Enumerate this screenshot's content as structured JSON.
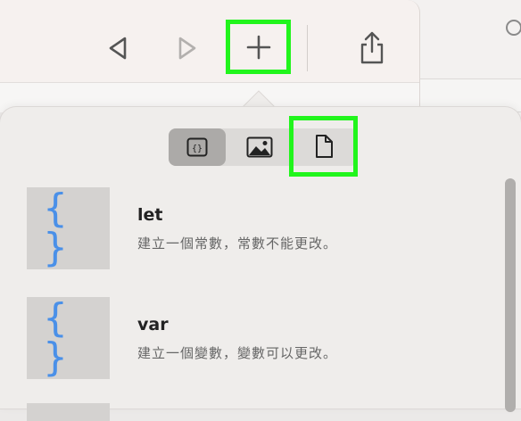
{
  "toolbar": {
    "back_icon": "chevron-left-icon",
    "forward_icon": "chevron-right-icon",
    "add_icon": "plus-icon",
    "share_icon": "share-icon",
    "highlight_color": "#21f51c"
  },
  "popover": {
    "segments": [
      {
        "icon": "code-braces-icon",
        "selected": true
      },
      {
        "icon": "image-icon",
        "selected": false
      },
      {
        "icon": "document-icon",
        "selected": false
      }
    ],
    "items": [
      {
        "title": "let",
        "description": "建立一個常數，常數不能更改。",
        "thumb": "{ }"
      },
      {
        "title": "var",
        "description": "建立一個變數，變數可以更改。",
        "thumb": "{ }"
      }
    ],
    "accent_color": "#4a90e8"
  }
}
